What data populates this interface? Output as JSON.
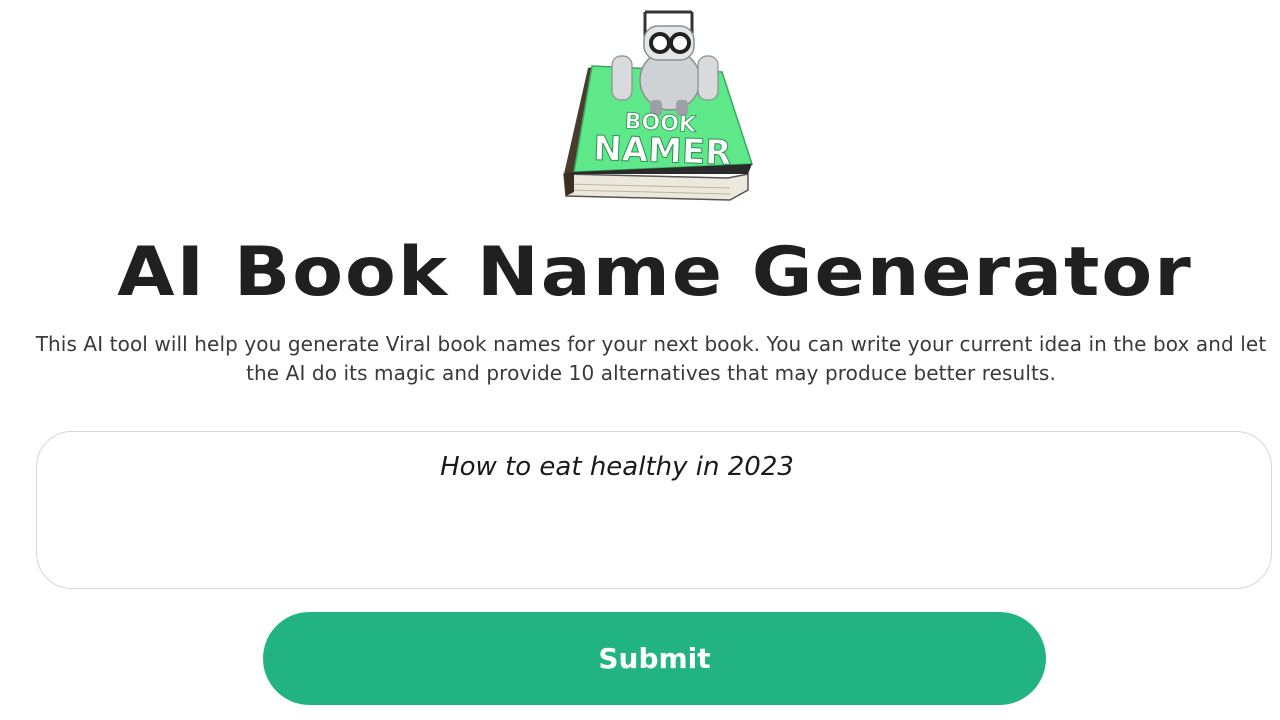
{
  "logo": {
    "line1": "BOOK",
    "line2": "NAMER",
    "icon": "robot-on-book-logo"
  },
  "header": {
    "title": "AI Book Name Generator",
    "description": "This AI tool will help you generate Viral book names for your next book. You can write your current idea in the box and let the AI do its magic and provide 10 alternatives that may produce better results."
  },
  "form": {
    "idea_value": "How to eat healthy in 2023",
    "submit_label": "Submit"
  },
  "colors": {
    "accent": "#22b382",
    "book_cover": "#5ee88a",
    "title_text": "#202020"
  }
}
